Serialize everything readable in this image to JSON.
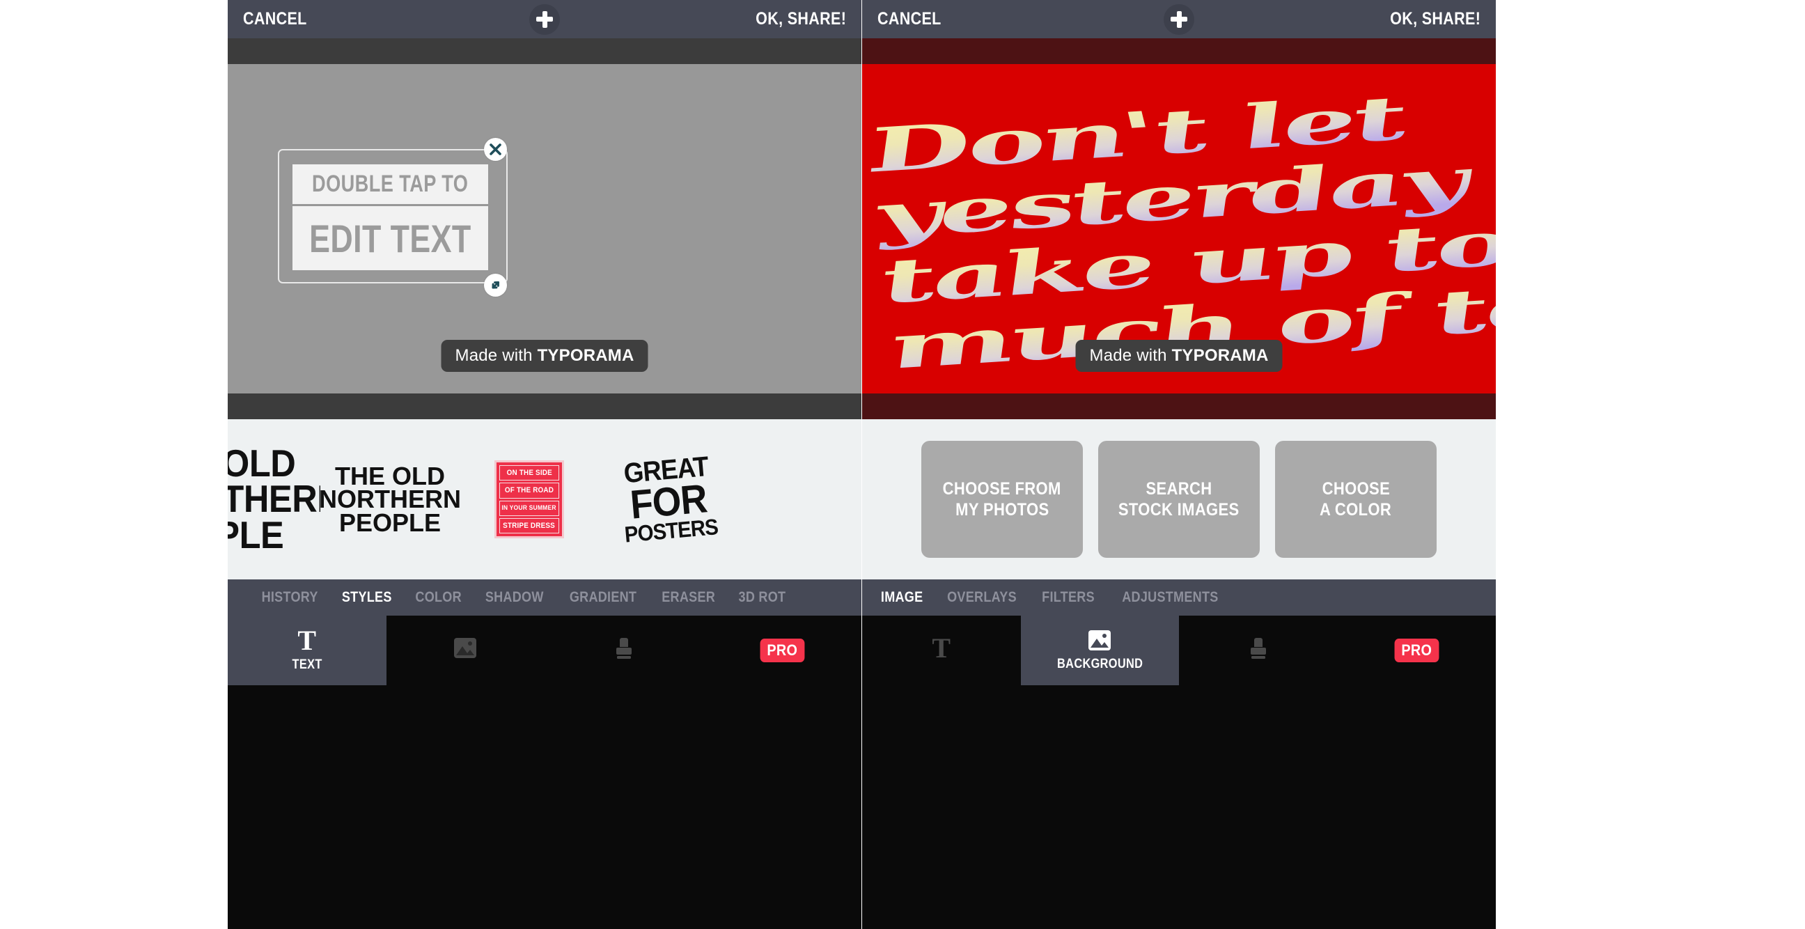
{
  "app": {
    "watermark": "Made with ",
    "watermark_brand": "TYPORAMA"
  },
  "colors": {
    "topbar_bg": "#464956",
    "left_canvas_bg": "#989898",
    "right_canvas_bg": "#d80000",
    "left_strip": "#3c3c3c",
    "right_strip": "#4d1214",
    "tray_bg": "#eef1f2",
    "tab_bar_bg": "#464956",
    "nav_bg": "#0a0a0a",
    "nav_active_bg": "#464956",
    "pro_badge": "#f5334b",
    "handle_glyph": "#1f4e5a",
    "preset_red": "#ee3049"
  },
  "left_panel": {
    "topbar": {
      "cancel": "CANCEL",
      "share": "OK, SHARE!",
      "add_icon": "plus-icon"
    },
    "textbox": {
      "line1": "DOUBLE TAP TO",
      "line2": "EDIT TEXT",
      "close_icon": "close-icon",
      "resize_icon": "resize-diagonal-icon"
    },
    "presets": [
      {
        "id": "preset1",
        "type": "text-stack-clipped",
        "lines": [
          "THE OLD",
          "NORTHERN",
          "PEOPLE"
        ]
      },
      {
        "id": "preset2",
        "type": "text-stack",
        "lines": [
          "THE OLD",
          "NORTHERN",
          "PEOPLE"
        ]
      },
      {
        "id": "preset3",
        "type": "red-box-stack",
        "lines": [
          "ON THE SIDE",
          "OF THE ROAD",
          "IN YOUR SUMMER",
          "STRIPE DRESS"
        ]
      },
      {
        "id": "preset4",
        "type": "text-stack-slanted",
        "lines": [
          "GREAT",
          "FOR",
          "POSTERS"
        ]
      }
    ],
    "tabs": [
      {
        "label": "HISTORY",
        "active": false
      },
      {
        "label": "STYLES",
        "active": true
      },
      {
        "label": "COLOR",
        "active": false
      },
      {
        "label": "SHADOW",
        "active": false
      },
      {
        "label": "GRADIENT",
        "active": false
      },
      {
        "label": "ERASER",
        "active": false
      },
      {
        "label": "3D ROT",
        "active": false
      }
    ],
    "nav": [
      {
        "label": "TEXT",
        "icon": "text-t-icon",
        "active": true
      },
      {
        "label": "",
        "icon": "image-icon",
        "active": false
      },
      {
        "label": "",
        "icon": "stamp-icon",
        "active": false
      },
      {
        "label": "PRO",
        "icon": "pro-badge",
        "active": false
      }
    ]
  },
  "right_panel": {
    "topbar": {
      "cancel": "CANCEL",
      "share": "OK, SHARE!",
      "add_icon": "plus-icon"
    },
    "artwork": {
      "lines": [
        "Don't let",
        "yesterday",
        "take up too",
        "much of today"
      ],
      "full_text": "Don't let yesterday take up too much of today",
      "gradient_from": "#f4eda2",
      "gradient_to": "#c2b2e8",
      "background": "#d80000"
    },
    "buttons": [
      {
        "line1": "CHOOSE FROM",
        "line2": "MY PHOTOS"
      },
      {
        "line1": "SEARCH",
        "line2": "STOCK IMAGES"
      },
      {
        "line1": "CHOOSE",
        "line2": "A COLOR"
      }
    ],
    "tabs": [
      {
        "label": "IMAGE",
        "active": true
      },
      {
        "label": "OVERLAYS",
        "active": false
      },
      {
        "label": "FILTERS",
        "active": false
      },
      {
        "label": "ADJUSTMENTS",
        "active": false
      }
    ],
    "nav": [
      {
        "label": "",
        "icon": "text-t-icon",
        "active": false
      },
      {
        "label": "BACKGROUND",
        "icon": "image-icon",
        "active": true
      },
      {
        "label": "",
        "icon": "stamp-icon",
        "active": false
      },
      {
        "label": "PRO",
        "icon": "pro-badge",
        "active": false
      }
    ]
  }
}
